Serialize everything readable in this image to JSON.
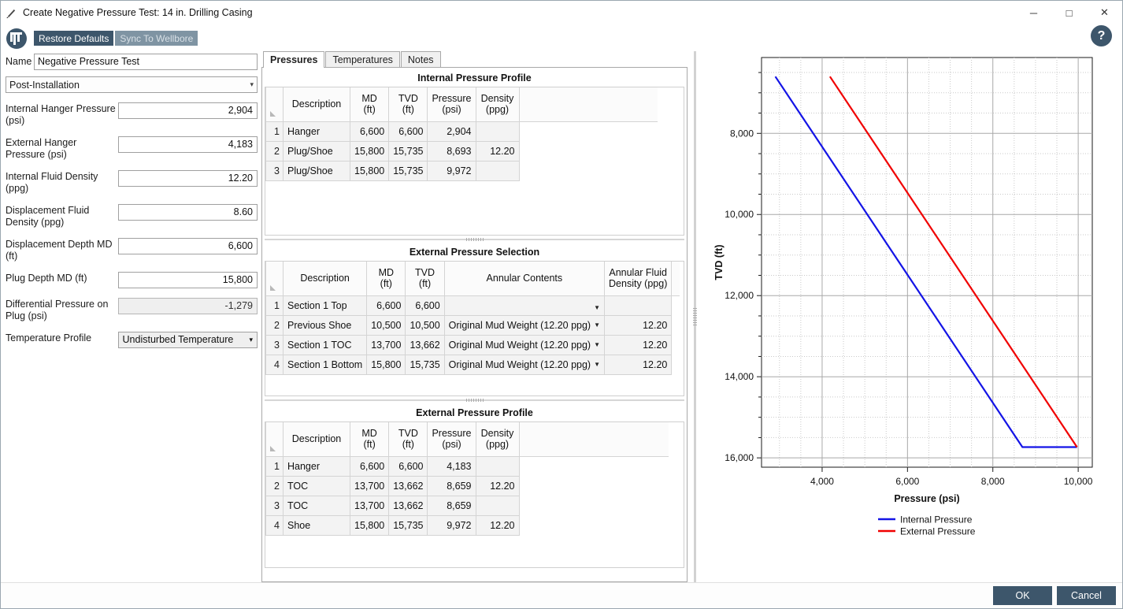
{
  "window": {
    "title": "Create Negative Pressure Test: 14 in. Drilling Casing",
    "minimize": "─",
    "maximize": "□",
    "close": "✕",
    "help": "?"
  },
  "toolbar": {
    "restore_defaults": "Restore Defaults",
    "sync_to_wellbore": "Sync To Wellbore"
  },
  "left_panel": {
    "name_label": "Name",
    "name_value": "Negative Pressure Test",
    "name_placeholder": "Name",
    "stage_value": "Post-Installation",
    "fields": [
      {
        "label": "Internal Hanger Pressure (psi)",
        "value": "2,904",
        "readonly": false
      },
      {
        "label": "External Hanger Pressure (psi)",
        "value": "4,183",
        "readonly": false
      },
      {
        "label": "Internal Fluid Density (ppg)",
        "value": "12.20",
        "readonly": false
      },
      {
        "label": "Displacement Fluid Density (ppg)",
        "value": "8.60",
        "readonly": false
      },
      {
        "label": "Displacement Depth MD (ft)",
        "value": "6,600",
        "readonly": false
      },
      {
        "label": "Plug Depth MD (ft)",
        "value": "15,800",
        "readonly": false
      },
      {
        "label": "Differential Pressure on Plug (psi)",
        "value": "-1,279",
        "readonly": true
      }
    ],
    "temperature_profile_label": "Temperature Profile",
    "temperature_profile_value": "Undisturbed Temperature"
  },
  "tabs": [
    {
      "label": "Pressures",
      "active": true
    },
    {
      "label": "Temperatures",
      "active": false
    },
    {
      "label": "Notes",
      "active": false
    }
  ],
  "internal_pressure_profile": {
    "title": "Internal Pressure Profile",
    "columns": [
      "Description",
      "MD (ft)",
      "TVD (ft)",
      "Pressure (psi)",
      "Density (ppg)"
    ],
    "rows": [
      {
        "n": "1",
        "description": "Hanger",
        "md": "6,600",
        "tvd": "6,600",
        "pressure": "2,904",
        "density": ""
      },
      {
        "n": "2",
        "description": "Plug/Shoe",
        "md": "15,800",
        "tvd": "15,735",
        "pressure": "8,693",
        "density": "12.20"
      },
      {
        "n": "3",
        "description": "Plug/Shoe",
        "md": "15,800",
        "tvd": "15,735",
        "pressure": "9,972",
        "density": ""
      }
    ]
  },
  "external_pressure_selection": {
    "title": "External Pressure Selection",
    "columns": [
      "Description",
      "MD (ft)",
      "TVD (ft)",
      "Annular Contents",
      "Annular Fluid Density (ppg)"
    ],
    "rows": [
      {
        "n": "1",
        "description": "Section 1 Top",
        "md": "6,600",
        "tvd": "6,600",
        "contents": "",
        "density": ""
      },
      {
        "n": "2",
        "description": "Previous Shoe",
        "md": "10,500",
        "tvd": "10,500",
        "contents": "Original Mud Weight (12.20 ppg)",
        "density": "12.20"
      },
      {
        "n": "3",
        "description": "Section 1 TOC",
        "md": "13,700",
        "tvd": "13,662",
        "contents": "Original Mud Weight (12.20 ppg)",
        "density": "12.20"
      },
      {
        "n": "4",
        "description": "Section 1 Bottom",
        "md": "15,800",
        "tvd": "15,735",
        "contents": "Original Mud Weight (12.20 ppg)",
        "density": "12.20"
      }
    ]
  },
  "external_pressure_profile": {
    "title": "External Pressure Profile",
    "columns": [
      "Description",
      "MD (ft)",
      "TVD (ft)",
      "Pressure (psi)",
      "Density (ppg)"
    ],
    "rows": [
      {
        "n": "1",
        "description": "Hanger",
        "md": "6,600",
        "tvd": "6,600",
        "pressure": "4,183",
        "density": ""
      },
      {
        "n": "2",
        "description": "TOC",
        "md": "13,700",
        "tvd": "13,662",
        "pressure": "8,659",
        "density": "12.20"
      },
      {
        "n": "3",
        "description": "TOC",
        "md": "13,700",
        "tvd": "13,662",
        "pressure": "8,659",
        "density": ""
      },
      {
        "n": "4",
        "description": "Shoe",
        "md": "15,800",
        "tvd": "15,735",
        "pressure": "9,972",
        "density": "12.20"
      }
    ]
  },
  "chart_data": {
    "type": "line",
    "title": "",
    "xlabel": "Pressure (psi)",
    "ylabel": "TVD (ft)",
    "xlim": [
      2580,
      10330
    ],
    "ylim": [
      16230,
      6130
    ],
    "y_inverted": true,
    "grid": true,
    "xticks": [
      4000,
      6000,
      8000,
      10000
    ],
    "xtick_labels": [
      "4,000",
      "6,000",
      "8,000",
      "10,000"
    ],
    "yticks": [
      8000,
      10000,
      12000,
      14000,
      16000
    ],
    "ytick_labels": [
      "8,000",
      "10,000",
      "12,000",
      "14,000",
      "16,000"
    ],
    "legend_position": "bottom",
    "series": [
      {
        "name": "Internal Pressure",
        "color": "#1414e6",
        "points": [
          {
            "x": 2904,
            "y": 6600
          },
          {
            "x": 8693,
            "y": 15735
          },
          {
            "x": 9972,
            "y": 15735
          }
        ]
      },
      {
        "name": "External Pressure",
        "color": "#f00000",
        "points": [
          {
            "x": 4183,
            "y": 6600
          },
          {
            "x": 8659,
            "y": 13662
          },
          {
            "x": 9972,
            "y": 15735
          }
        ]
      }
    ]
  },
  "footer": {
    "ok": "OK",
    "cancel": "Cancel"
  }
}
